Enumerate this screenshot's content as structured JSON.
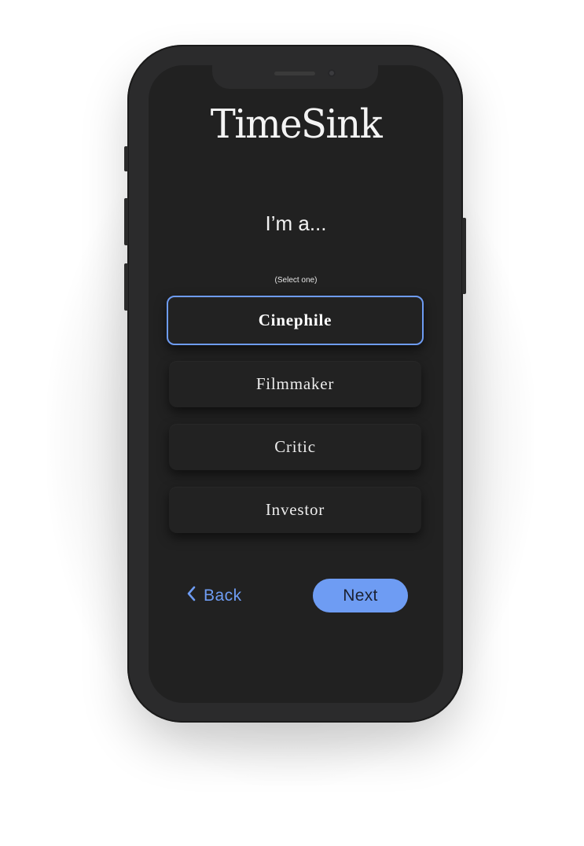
{
  "app": {
    "logo": "TimeSink"
  },
  "onboarding": {
    "heading": "I’m a...",
    "hint": "(Select one)",
    "options": [
      {
        "label": "Cinephile",
        "selected": true
      },
      {
        "label": "Filmmaker",
        "selected": false
      },
      {
        "label": "Critic",
        "selected": false
      },
      {
        "label": "Investor",
        "selected": false
      }
    ]
  },
  "nav": {
    "back_label": "Back",
    "back_icon": "chevron-left-icon",
    "next_label": "Next"
  },
  "colors": {
    "accent": "#6e9cf3",
    "screen_bg": "#212121",
    "option_bg": "#222222",
    "device_frame": "#2b2b2c"
  }
}
